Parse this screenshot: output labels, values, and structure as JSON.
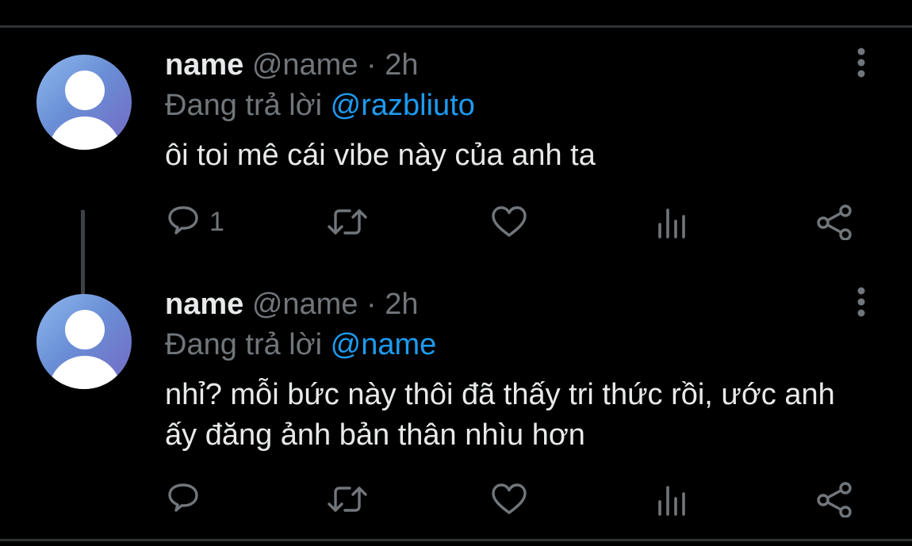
{
  "colors": {
    "background": "#000000",
    "divider": "#2f3336",
    "text_primary": "#e7e9ea",
    "text_secondary": "#71767b",
    "mention": "#1d9bf0"
  },
  "tweets": [
    {
      "name": "name",
      "handle": "@name",
      "separator": "·",
      "time": "2h",
      "replying_prefix": "Đang trả lời",
      "replying_to": "@razbliuto",
      "text": "ôi toi mê cái vibe này của anh ta",
      "reply_count": "1",
      "icons": [
        "avatar-placeholder",
        "more-vertical-icon",
        "reply-icon",
        "retweet-icon",
        "like-icon",
        "views-icon",
        "share-icon"
      ]
    },
    {
      "name": "name",
      "handle": "@name",
      "separator": "·",
      "time": "2h",
      "replying_prefix": "Đang trả lời",
      "replying_to": "@name",
      "text": "nhỉ? mỗi bức này thôi đã thấy tri thức rồi, ước anh ấy đăng ảnh bản thân nhìu hơn",
      "reply_count": "",
      "icons": [
        "avatar-placeholder",
        "more-vertical-icon",
        "reply-icon",
        "retweet-icon",
        "like-icon",
        "views-icon",
        "share-icon"
      ]
    }
  ]
}
